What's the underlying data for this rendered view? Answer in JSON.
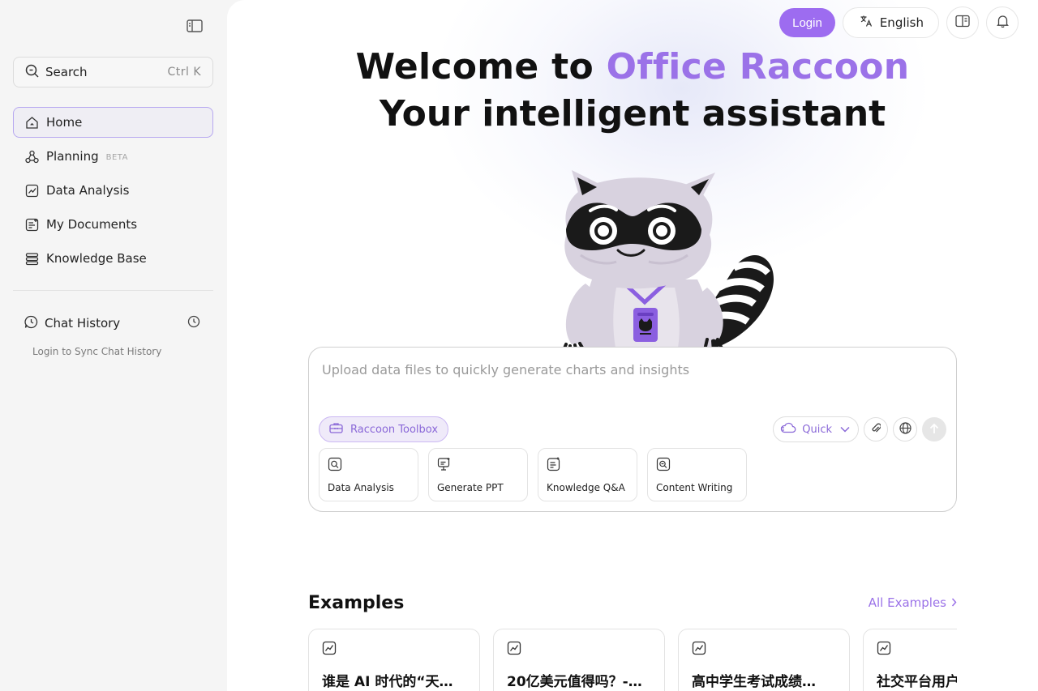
{
  "sidebar": {
    "search": {
      "label": "Search",
      "shortcut": "Ctrl K"
    },
    "nav": [
      {
        "label": "Home",
        "icon": "home-icon",
        "active": true
      },
      {
        "label": "Planning",
        "icon": "planning-icon",
        "badge": "BETA"
      },
      {
        "label": "Data Analysis",
        "icon": "chart-icon"
      },
      {
        "label": "My Documents",
        "icon": "document-icon"
      },
      {
        "label": "Knowledge Base",
        "icon": "database-icon"
      }
    ],
    "history": {
      "label": "Chat History",
      "subtitle": "Login to Sync Chat History"
    }
  },
  "topbar": {
    "login": "Login",
    "language": "English"
  },
  "hero": {
    "prefix": "Welcome to ",
    "brand": "Office Raccoon",
    "line2": "Your intelligent assistant"
  },
  "composer": {
    "placeholder": "Upload data files to quickly generate charts and insights",
    "toolbox": "Raccoon Toolbox",
    "mode": "Quick",
    "cards": [
      {
        "label": "Data Analysis",
        "icon": "data-search-icon"
      },
      {
        "label": "Generate PPT",
        "icon": "presentation-icon"
      },
      {
        "label": "Knowledge Q&A",
        "icon": "knowledge-icon"
      },
      {
        "label": "Content Writing",
        "icon": "writing-icon"
      }
    ]
  },
  "examples": {
    "title": "Examples",
    "all_label": "All Examples",
    "items": [
      {
        "title": "谁是 AI 时代的“天…"
      },
      {
        "title": "20亿美元值得吗？-…"
      },
      {
        "title": "高中学生考试成绩…"
      },
      {
        "title": "社交平台用户"
      }
    ]
  },
  "colors": {
    "accent": "#9d6cf0",
    "brand_text": "#9b72e8",
    "active_border": "#b7a8f0"
  }
}
